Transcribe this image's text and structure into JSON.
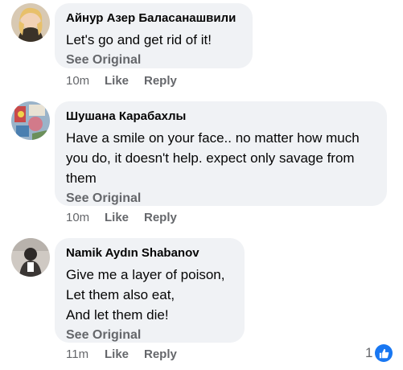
{
  "comments": [
    {
      "author": "Айнур Азер Баласанашвили",
      "text": "Let's go and get rid of it!",
      "see_original": "See Original",
      "time": "10m",
      "like_label": "Like",
      "reply_label": "Reply"
    },
    {
      "author": "Шушана Карабахлы",
      "text": "Have a smile on your face.. no matter how much\nyou do, it doesn't help. expect only savage from\nthem",
      "see_original": "See Original",
      "time": "10m",
      "like_label": "Like",
      "reply_label": "Reply"
    },
    {
      "author": "Namik Aydın Shabanov",
      "text": "Give me a layer of poison,\nLet them also eat,\nAnd let them die!",
      "see_original": "See Original",
      "time": "11m",
      "like_label": "Like",
      "reply_label": "Reply",
      "reaction_count": "1",
      "reaction_icon": "like-thumb-icon"
    }
  ],
  "colors": {
    "bubble": "#f0f2f5",
    "secondary_text": "#65676b",
    "like_blue": "#1877f2"
  }
}
